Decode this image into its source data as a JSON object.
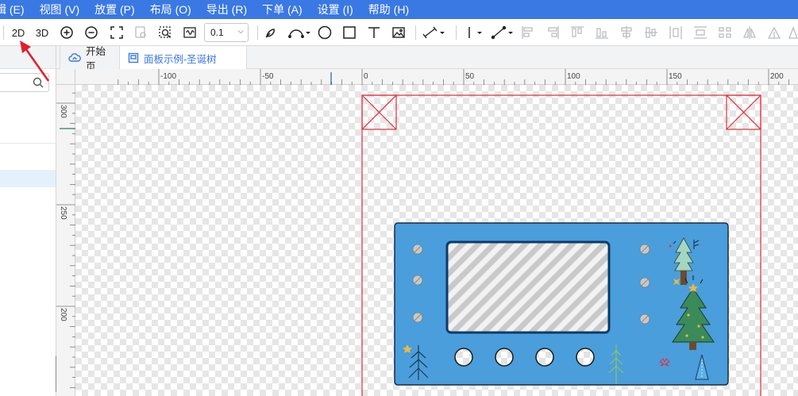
{
  "menu": {
    "items": [
      "辑 (E)",
      "视图 (V)",
      "放置 (P)",
      "布局 (O)",
      "导出 (R)",
      "下单 (A)",
      "设置 (I)",
      "帮助 (H)"
    ]
  },
  "toolbar": {
    "btn_2d": "2D",
    "btn_3d": "3D",
    "zoom_value": "0.1",
    "icons": [
      "zoom-in-icon",
      "zoom-out-icon",
      "fit-view-icon",
      "select-area-icon",
      "zoom-area-icon",
      "ruler-icon",
      "pen-icon",
      "arc-icon",
      "circle-icon",
      "rectangle-icon",
      "text-icon",
      "image-icon",
      "dimension-icon",
      "line-icon",
      "measure-icon",
      "align-icons"
    ]
  },
  "tabs": [
    {
      "label": "开始页",
      "icon": "cloud-icon"
    },
    {
      "label": "面板示例-圣诞树",
      "icon": "panel-icon"
    }
  ],
  "ruler": {
    "top_labels": [
      "-100",
      "-50",
      "0",
      "50",
      "100",
      "150",
      "200"
    ],
    "left_labels": [
      "300",
      "250",
      "200"
    ]
  },
  "colors": {
    "menubar": "#3a78e4",
    "panel_fill": "#4a9edb",
    "frame_red": "#e0303a",
    "accent_blue": "#3a78e4"
  }
}
